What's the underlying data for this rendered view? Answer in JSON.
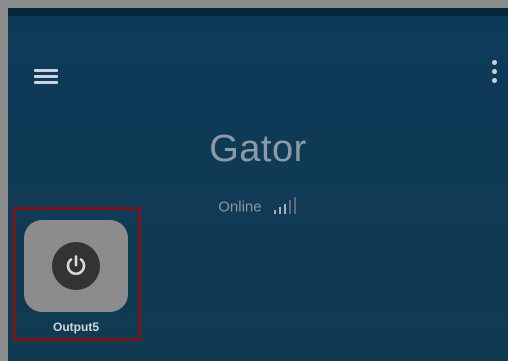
{
  "header": {
    "title": "Gator",
    "menu_icon": "hamburger-menu-icon",
    "more_icon": "more-vert-icon"
  },
  "status": {
    "text": "Online",
    "signal_icon": "signal-strength-icon",
    "signal_level": "3 of 5"
  },
  "outputs": [
    {
      "label": "Output5",
      "icon": "power-icon"
    }
  ],
  "colors": {
    "background": "#0f3a56",
    "tile": "#8c8c8c",
    "highlight": "#7a1418"
  }
}
